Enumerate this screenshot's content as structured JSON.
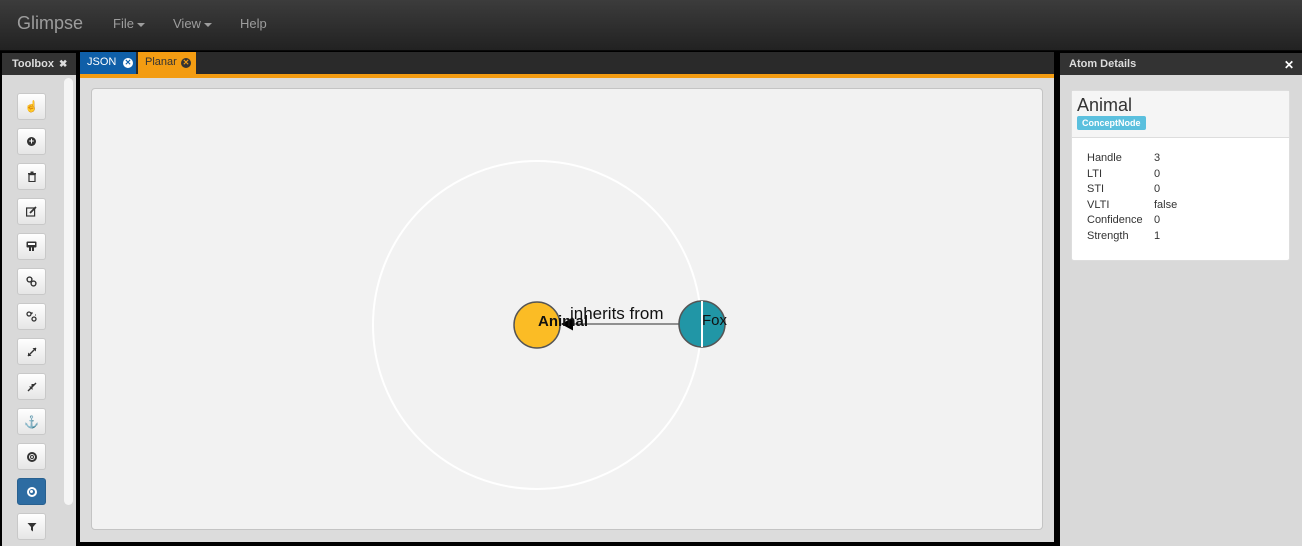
{
  "app": {
    "brand": "Glimpse",
    "menu": [
      "File",
      "View",
      "Help"
    ]
  },
  "toolbox": {
    "title": "Toolbox",
    "tools": [
      {
        "icon": "hand-pointer-icon"
      },
      {
        "icon": "add-circle-icon"
      },
      {
        "icon": "trash-icon"
      },
      {
        "icon": "edit-icon"
      },
      {
        "icon": "merge-icon"
      },
      {
        "icon": "link-icon"
      },
      {
        "icon": "unlink-icon"
      },
      {
        "icon": "expand-icon"
      },
      {
        "icon": "collapse-icon"
      },
      {
        "icon": "anchor-icon"
      },
      {
        "icon": "target-icon"
      },
      {
        "icon": "focus-icon",
        "active": true
      },
      {
        "icon": "filter-icon"
      }
    ]
  },
  "tabs": [
    {
      "label": "JSON",
      "color": "#0f5fa8"
    },
    {
      "label": "Planar",
      "color": "#f39c12",
      "active": true
    }
  ],
  "graph": {
    "nodes": [
      {
        "label": "Animal",
        "color": "#fbbc25"
      },
      {
        "label": "Fox",
        "color": "#2196a6"
      }
    ],
    "edges": [
      {
        "label": "inherits from"
      }
    ]
  },
  "details": {
    "title": "Atom Details",
    "atom_name": "Animal",
    "atom_type": "ConceptNode",
    "properties": [
      {
        "key": "Handle",
        "value": "3"
      },
      {
        "key": "LTI",
        "value": "0"
      },
      {
        "key": "STI",
        "value": "0"
      },
      {
        "key": "VLTI",
        "value": "false"
      },
      {
        "key": "Confidence",
        "value": "0"
      },
      {
        "key": "Strength",
        "value": "1"
      }
    ]
  }
}
